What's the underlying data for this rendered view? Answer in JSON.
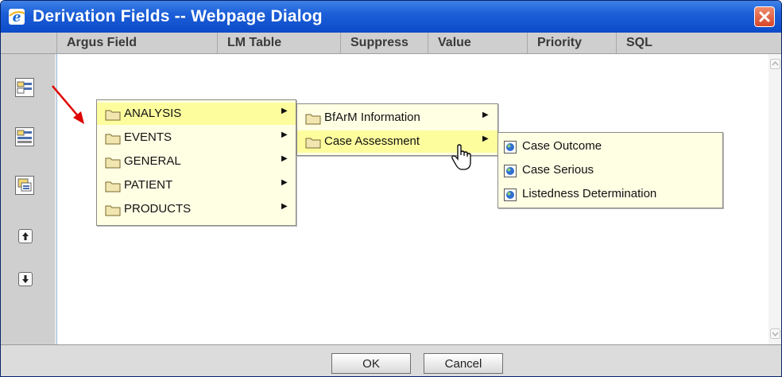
{
  "dialog": {
    "title": "Derivation Fields -- Webpage Dialog"
  },
  "columns": [
    "Argus Field",
    "LM Table",
    "Suppress",
    "Value",
    "Priority",
    "SQL"
  ],
  "menus": {
    "level1": [
      "ANALYSIS",
      "EVENTS",
      "GENERAL",
      "PATIENT",
      "PRODUCTS"
    ],
    "level2": [
      "BfArM Information",
      "Case Assessment"
    ],
    "level3": [
      "Case Outcome",
      "Case Serious",
      "Listedness Determination"
    ],
    "highlighted": [
      "ANALYSIS",
      "Case Assessment"
    ]
  },
  "footer": {
    "ok_label": "OK",
    "cancel_label": "Cancel"
  },
  "colors": {
    "titlebar": "#1c5fd8",
    "menu_bg": "#ffffe4",
    "menu_highlight": "#fdfd9e",
    "annotation_arrow": "#e00000"
  }
}
